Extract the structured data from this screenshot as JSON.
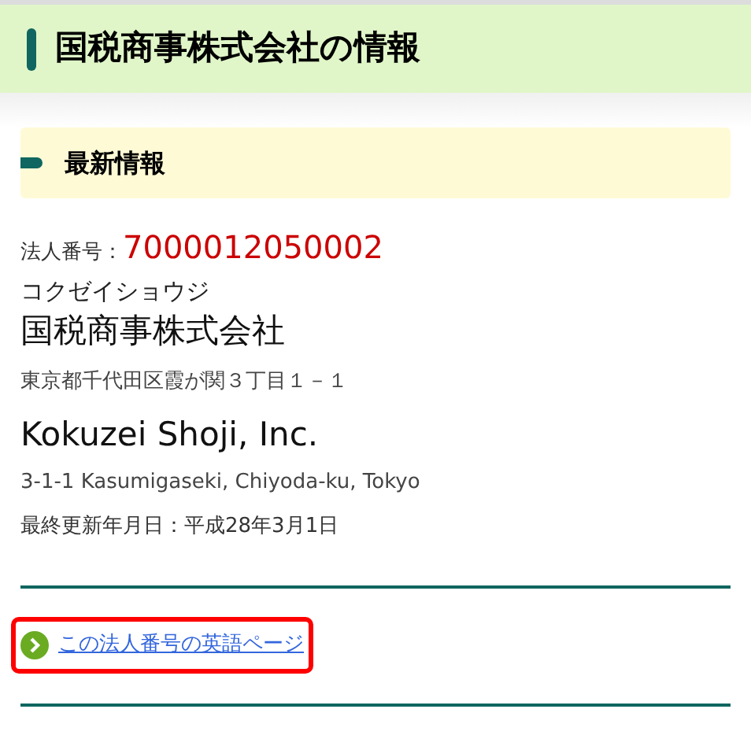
{
  "page_title": "国税商事株式会社の情報",
  "section": {
    "heading": "最新情報",
    "corporate_number_label": "法人番号：",
    "corporate_number": "7000012050002",
    "name_kana": "コクゼイショウジ",
    "name": "国税商事株式会社",
    "address": "東京都千代田区霞が関３丁目１－１",
    "name_en": "Kokuzei Shoji, Inc.",
    "address_en": "3-1-1 Kasumigaseki, Chiyoda-ku, Tokyo",
    "updated": "最終更新年月日：平成28年3月1日"
  },
  "link": {
    "label": "この法人番号の英語ページ",
    "highlighted": true
  }
}
